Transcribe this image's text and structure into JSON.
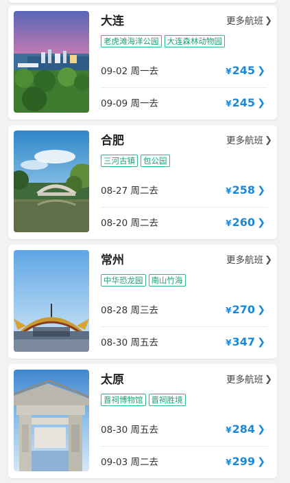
{
  "cards": [
    {
      "city": "大连",
      "more_label": "更多航班",
      "tags": [
        "老虎滩海洋公园",
        "大连森林动物园"
      ],
      "flights": [
        {
          "date": "09-02 周一去",
          "currency": "¥",
          "price": "245"
        },
        {
          "date": "09-09 周一去",
          "currency": "¥",
          "price": "245"
        }
      ]
    },
    {
      "city": "合肥",
      "more_label": "更多航班",
      "tags": [
        "三河古镇",
        "包公园"
      ],
      "flights": [
        {
          "date": "08-27 周二去",
          "currency": "¥",
          "price": "258"
        },
        {
          "date": "08-20 周二去",
          "currency": "¥",
          "price": "260"
        }
      ]
    },
    {
      "city": "常州",
      "more_label": "更多航班",
      "tags": [
        "中华恐龙园",
        "南山竹海"
      ],
      "flights": [
        {
          "date": "08-28 周三去",
          "currency": "¥",
          "price": "270"
        },
        {
          "date": "08-30 周五去",
          "currency": "¥",
          "price": "347"
        }
      ]
    },
    {
      "city": "太原",
      "more_label": "更多航班",
      "tags": [
        "晋祠博物馆",
        "晋祠胜境"
      ],
      "flights": [
        {
          "date": "08-30 周五去",
          "currency": "¥",
          "price": "284"
        },
        {
          "date": "09-03 周二去",
          "currency": "¥",
          "price": "299"
        }
      ]
    }
  ],
  "colors": {
    "price": "#1a88d8",
    "tag_border": "#2eb88b",
    "tag_text": "#1f9f74",
    "background": "#f1f2f4"
  },
  "icons": {
    "more_chevron": "chevron-right-icon",
    "price_chevron": "chevron-right-icon"
  }
}
